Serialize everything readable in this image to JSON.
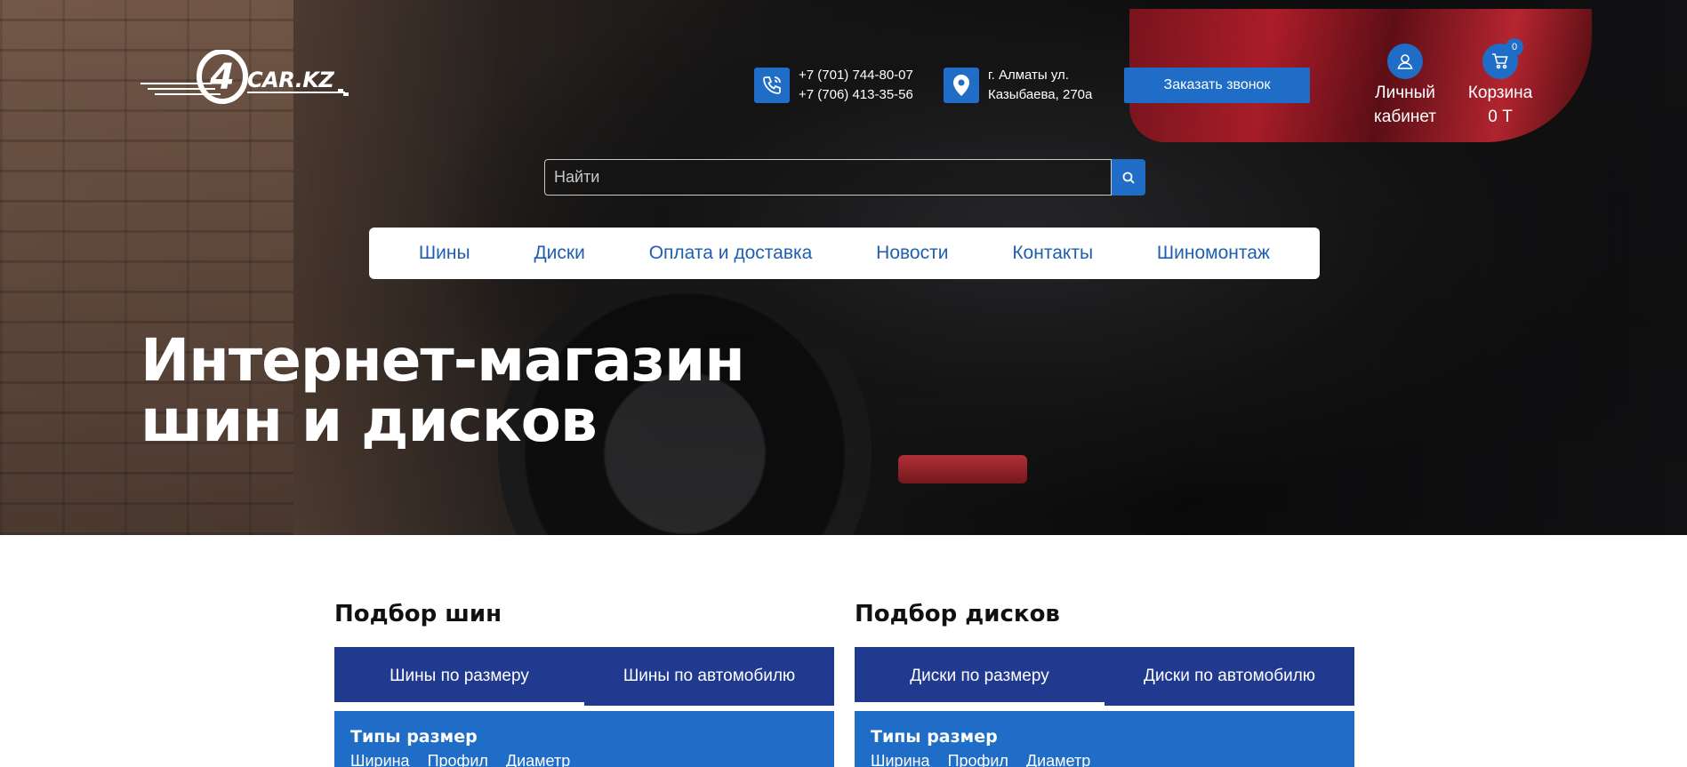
{
  "header": {
    "logo_text": "CAR.KZ",
    "logo_mark": "4",
    "phones": [
      "+7 (701) 744-80-07",
      "+7 (706) 413-35-56"
    ],
    "address": [
      "г. Алматы ул.",
      "Казыбаева, 270а"
    ],
    "callback_label": "Заказать звонок",
    "account_label_1": "Личный",
    "account_label_2": "кабинет",
    "cart_label": "Корзина",
    "cart_total": "0 Т",
    "cart_count": "0"
  },
  "search": {
    "placeholder": "Найти"
  },
  "nav": {
    "items": [
      "Шины",
      "Диски",
      "Оплата и доставка",
      "Новости",
      "Контакты",
      "Шиномонтаж"
    ]
  },
  "hero": {
    "title_line1": "Интернет-магазин",
    "title_line2": "шин и дисков"
  },
  "selectors": [
    {
      "title": "Подбор шин",
      "tabs": [
        "Шины по размеру",
        "Шины по автомобилю"
      ],
      "body_heading": "Типы размер",
      "columns": [
        "Ширина",
        "Профил",
        "Диаметр"
      ]
    },
    {
      "title": "Подбор дисков",
      "tabs": [
        "Диски по размеру",
        "Диски по автомобилю"
      ],
      "body_heading": "Типы размер",
      "columns": [
        "Ширина",
        "Профил",
        "Диаметр"
      ]
    }
  ],
  "colors": {
    "accent": "#1f6dc7",
    "tabs_bg": "#203a8f",
    "nav_text": "#1f5fb0"
  }
}
